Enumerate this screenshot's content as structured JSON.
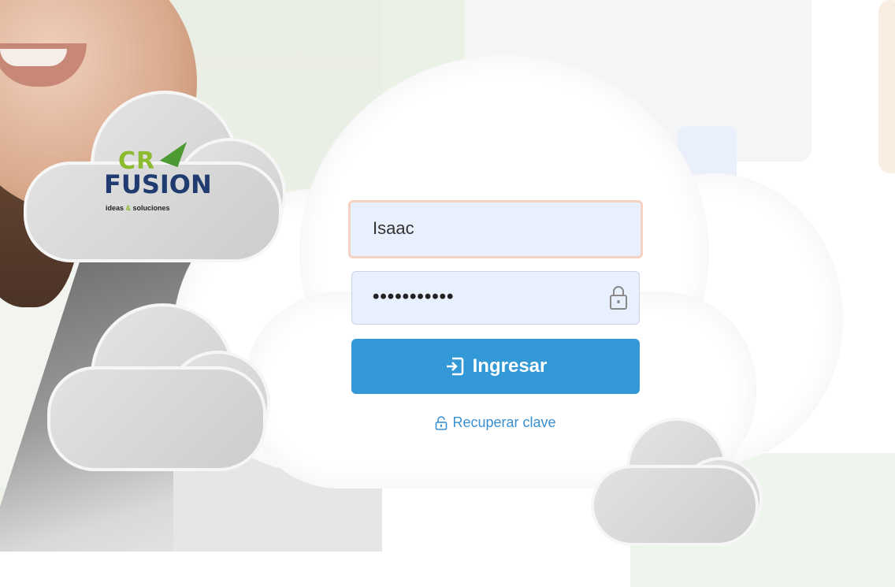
{
  "brand": {
    "logo_line1": "CR",
    "logo_line2": "FUSION",
    "logo_tagline_a": "ideas",
    "logo_tagline_amp": "&",
    "logo_tagline_b": "soluciones"
  },
  "login": {
    "username_value": "Isaac",
    "password_value": "•••••••••••",
    "submit_label": "Ingresar",
    "recover_label": "Recuperar clave"
  },
  "icons": {
    "password": "lock-icon",
    "submit": "sign-in-icon",
    "recover": "unlock-icon"
  },
  "colors": {
    "primary": "#3399d6",
    "link": "#3a8fd0",
    "input_bg": "#e8f0fe",
    "focus_border": "#f6d2c4"
  }
}
